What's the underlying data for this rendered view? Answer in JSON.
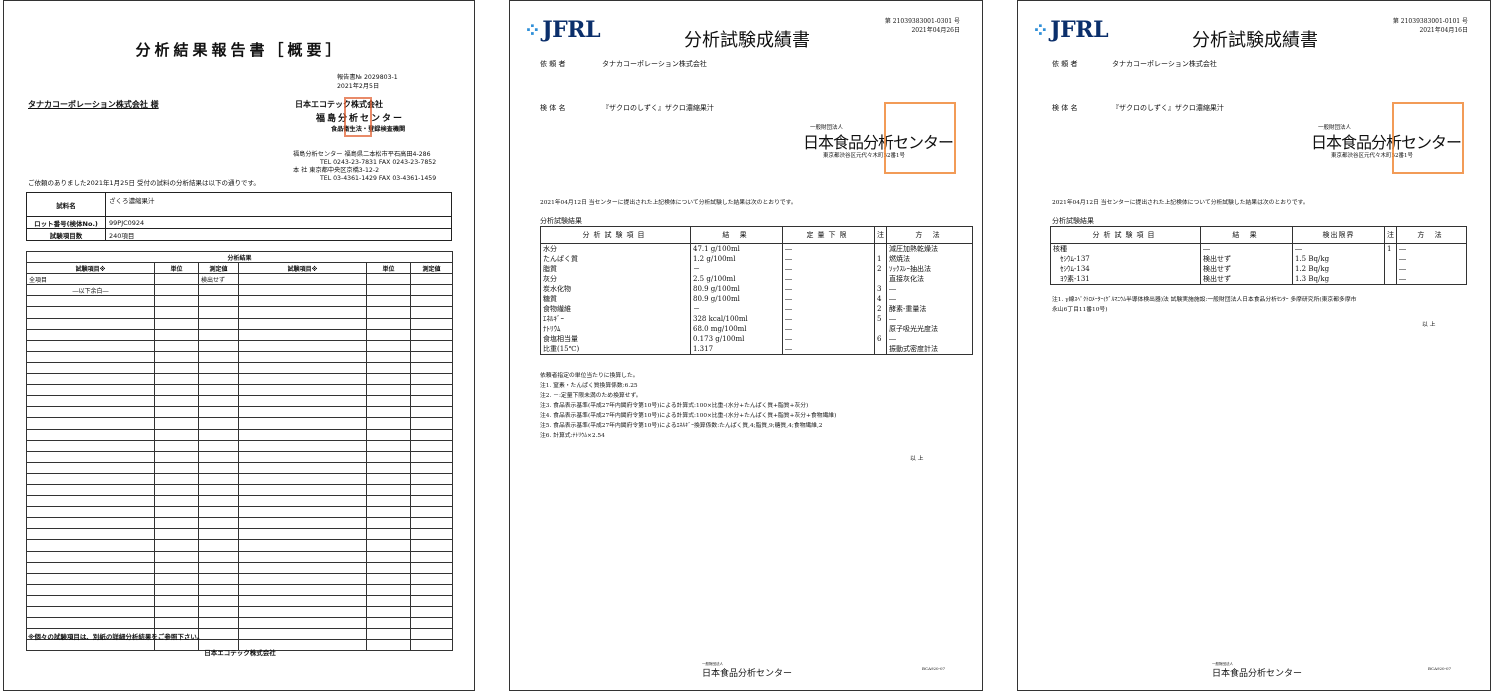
{
  "page1": {
    "title": "分析結果報告書［概要］",
    "report_no": "報告書№ 2029803-1",
    "report_date": "2021年2月5日",
    "client": "タナカコーポレーション株式会社 様",
    "company": "日本エコテック株式会社",
    "center": "福島分析センター",
    "center_sub": "食品衛生法・登録検査機関",
    "addr1": "福島分析センター 福島県二本松市平石高田4-286",
    "tel1": "TEL 0243-23-7831 FAX 0243-23-7852",
    "addr2": "本 社 東京都中央区京橋3-12-2",
    "tel2": "TEL 03-4361-1429 FAX 03-4361-1459",
    "intro": "ご依頼のありました2021年1月25日 受付の試料の分析結果は以下の通りです。",
    "info_rows": [
      {
        "label": "試料名",
        "value": "ざくろ濃縮果汁"
      },
      {
        "label": "ロット番号(検体No.)",
        "value": "99PJC0924"
      },
      {
        "label": "試験項目数",
        "value": "240項目"
      }
    ],
    "table_title": "分析結果",
    "headers": [
      "試験項目※",
      "単位",
      "測定値",
      "試験項目※",
      "単位",
      "測定値"
    ],
    "row1": {
      "item": "全項目",
      "unit": "",
      "value": "検出せず"
    },
    "row2": {
      "item": "―以下余白―"
    },
    "footnote": "※個々の試験項目は、別紙の詳細分析結果をご参照下さい。",
    "footer": "日本エコテック株式会社"
  },
  "page2": {
    "logo": "JFRL",
    "title": "分析試験成績書",
    "no": "第 21039383001-0301 号",
    "date": "2021年04月26日",
    "client_label": "依 頼 者",
    "client": "タナカコーポレーション株式会社",
    "sample_label": "検 体 名",
    "sample": "『ザクロのしずく』ザクロ濃縮果汁",
    "org_small": "一般財団法人",
    "org": "日本食品分析センター",
    "org_addr": "東京都渋谷区元代々木町52番1号",
    "intro": "2021年04月12日 当センターに提出された上記検体について分析試験した結果は次のとおりです。",
    "section": "分析試験結果",
    "headers": [
      "分析試験項目",
      "結 果",
      "定量下限",
      "注",
      "方 法"
    ],
    "rows": [
      {
        "item": "水分",
        "result": "47.1 g/100ml",
        "limit": "―",
        "note": "",
        "method": "減圧加熱乾燥法"
      },
      {
        "item": "たんぱく質",
        "result": "1.2 g/100ml",
        "limit": "―",
        "note": "1",
        "method": "燃焼法"
      },
      {
        "item": "脂質",
        "result": "－",
        "limit": "―",
        "note": "2",
        "method": "ｿｯｸｽﾚｰ抽出法"
      },
      {
        "item": "灰分",
        "result": "2.5 g/100ml",
        "limit": "―",
        "note": "",
        "method": "直接灰化法"
      },
      {
        "item": "炭水化物",
        "result": "80.9 g/100ml",
        "limit": "―",
        "note": "3",
        "method": "―"
      },
      {
        "item": "糖質",
        "result": "80.9 g/100ml",
        "limit": "―",
        "note": "4",
        "method": "―"
      },
      {
        "item": "食物繊維",
        "result": "－",
        "limit": "―",
        "note": "2",
        "method": "酵素-重量法"
      },
      {
        "item": "ｴﾈﾙｷﾞｰ",
        "result": "328 kcal/100ml",
        "limit": "―",
        "note": "5",
        "method": "―"
      },
      {
        "item": "ﾅﾄﾘｳﾑ",
        "result": "68.0 mg/100ml",
        "limit": "―",
        "note": "",
        "method": "原子吸光光度法"
      },
      {
        "item": "食塩相当量",
        "result": "0.173 g/100ml",
        "limit": "―",
        "note": "6",
        "method": "―"
      },
      {
        "item": "比重(15℃)",
        "result": "1.317",
        "limit": "―",
        "note": "",
        "method": "振動式密度計法"
      }
    ],
    "notes": [
      "依頼者指定の単位当たりに換算した。",
      "注1. 窒素・たんぱく質換算係数:6.25",
      "注2. －:定量下限未満のため換算せず。",
      "注3. 食品表示基準(平成27年内閣府令第10号)による計算式:100×比重-(水分+たんぱく質+脂質+灰分)",
      "注4. 食品表示基準(平成27年内閣府令第10号)による計算式:100×比重-(水分+たんぱく質+脂質+灰分+食物繊維)",
      "注5. 食品表示基準(平成27年内閣府令第10号)によるｴﾈﾙｷﾞｰ換算係数:たんぱく質,4;脂質,9;糖質,4;食物繊維,2",
      "注6. 計算式:ﾅﾄﾘｳﾑ×2.54"
    ],
    "end": "以 上",
    "footer_small": "一般財団法人",
    "footer": "日本食品分析センター",
    "code": "BCA920-07"
  },
  "page3": {
    "logo": "JFRL",
    "title": "分析試験成績書",
    "no": "第 21039383001-0101 号",
    "date": "2021年04月16日",
    "client_label": "依 頼 者",
    "client": "タナカコーポレーション株式会社",
    "sample_label": "検 体 名",
    "sample": "『ザクロのしずく』ザクロ濃縮果汁",
    "org_small": "一般財団法人",
    "org": "日本食品分析センター",
    "org_addr": "東京都渋谷区元代々木町52番1号",
    "intro": "2021年04月12日 当センターに提出された上記検体について分析試験した結果は次のとおりです。",
    "section": "分析試験結果",
    "headers": [
      "分析試験項目",
      "結 果",
      "検出限界",
      "注",
      "方 法"
    ],
    "rows": [
      {
        "item": "核種",
        "result": "―",
        "limit": "―",
        "note": "1",
        "method": "―"
      },
      {
        "item": "　ｾｼｳﾑ-137",
        "result": "検出せず",
        "limit": "1.5 Bq/kg",
        "note": "",
        "method": "―"
      },
      {
        "item": "　ｾｼｳﾑ-134",
        "result": "検出せず",
        "limit": "1.2 Bq/kg",
        "note": "",
        "method": "―"
      },
      {
        "item": "　ﾖｳ素-131",
        "result": "検出せず",
        "limit": "1.3 Bq/kg",
        "note": "",
        "method": "―"
      }
    ],
    "notes": [
      "注1. γ線ｽﾍﾟｸﾄﾛﾒｰﾀｰ(ｹﾞﾙﾏﾆｳﾑ半導体検出器)法 試験実施施設:一般財団法人日本食品分析ｾﾝﾀｰ 多摩研究所(東京都多摩市",
      "永山6丁目11番10号)"
    ],
    "end": "以 上",
    "footer_small": "一般財団法人",
    "footer": "日本食品分析センター",
    "code": "BCA920-07"
  },
  "colors": {
    "stamp_red": "#e05a2a",
    "stamp_orange": "#f08a3a",
    "logo_blue": "#0b2f6b",
    "logo_dots": "#2f8fd8"
  }
}
